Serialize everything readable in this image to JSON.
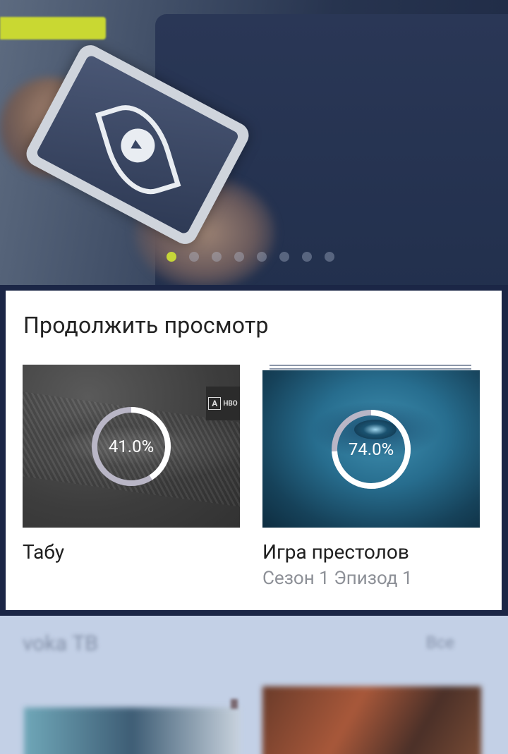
{
  "hero": {
    "badge_text": "",
    "dots_count": 8,
    "active_dot": 0,
    "accent_color": "#c6d639"
  },
  "continue_watching": {
    "title": "Продолжить просмотр",
    "items": [
      {
        "title": "Табу",
        "subtitle": "",
        "progress_percent": 41.0,
        "progress_label": "41.0%",
        "badge_letter": "A",
        "badge_network": "HBO"
      },
      {
        "title": "Игра престолов",
        "subtitle": "Сезон 1 Эпизод 1",
        "progress_percent": 74.0,
        "progress_label": "74.0%"
      }
    ]
  },
  "next_section": {
    "title": "voka ТВ",
    "all_label": "Все"
  }
}
